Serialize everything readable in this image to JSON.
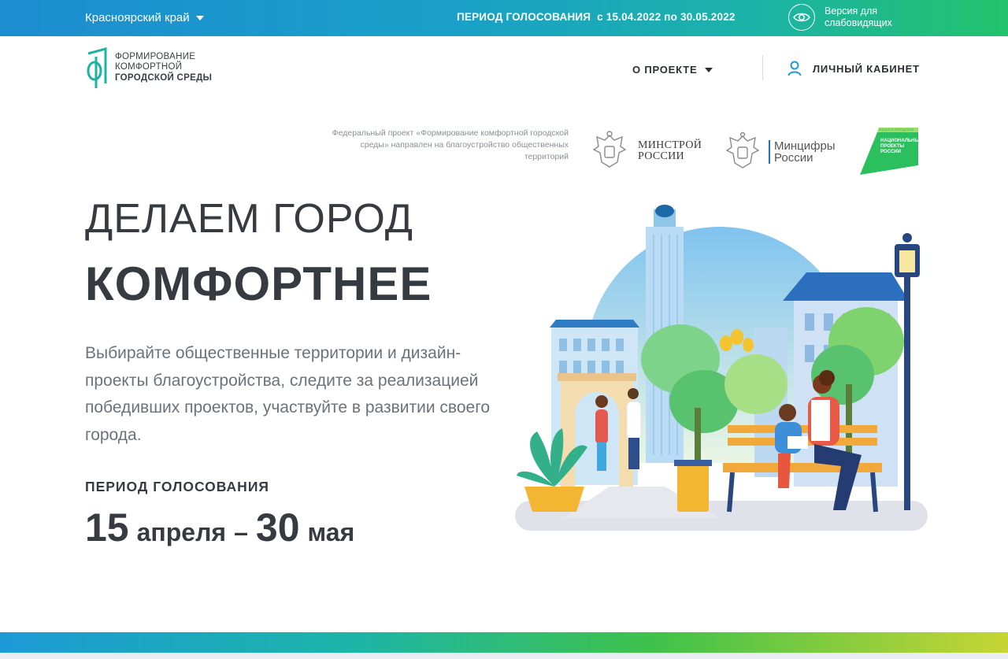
{
  "topbar": {
    "region": "Красноярский край",
    "period": "ПЕРИОД ГОЛОСОВАНИЯ  с 15.04.2022 по 30.05.2022",
    "vision_line1": "Версия для",
    "vision_line2": "слабовидящих"
  },
  "logo": {
    "line1": "ФОРМИРОВАНИЕ",
    "line2": "КОМФОРТНОЙ",
    "line3": "ГОРОДСКОЙ СРЕДЫ"
  },
  "nav": {
    "about": "О ПРОЕКТЕ",
    "cabinet": "ЛИЧНЫЙ КАБИНЕТ"
  },
  "federal_text": "Федеральный проект «Формирование комфортной городской среды» направлен на благоустройство общественных территорий",
  "partners": {
    "minstroy_line1": "МИНСТРОЙ",
    "minstroy_line2": "РОССИИ",
    "mincifry_line1": "Минцифры",
    "mincifry_line2": "России",
    "np_small": "ЖИЛЬЕ И ГОРОДСКАЯ СРЕДА",
    "np_line1": "НАЦИОНАЛЬНЫЕ",
    "np_line2": "ПРОЕКТЫ",
    "np_line3": "РОССИИ"
  },
  "hero": {
    "headline1": "ДЕЛАЕМ ГОРОД",
    "headline2": "КОМФОРТНЕЕ",
    "description": "Выбирайте общественные территории и дизайн-проекты благоустройства, следите за реализацией победивших проектов, участвуйте в развитии своего города.",
    "period_label": "ПЕРИОД ГОЛОСОВАНИЯ",
    "start_day": "15",
    "start_month": "апреля",
    "dash": "–",
    "end_day": "30",
    "end_month": "мая"
  },
  "colors": {
    "accent_blue": "#1c8dd0",
    "accent_green": "#23c26b",
    "text_dark": "#363b42",
    "text_muted": "#6b727a"
  }
}
